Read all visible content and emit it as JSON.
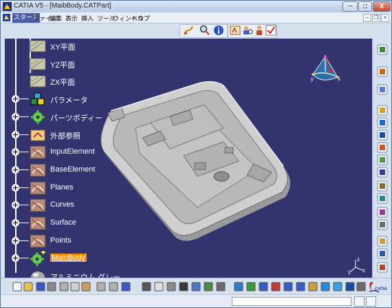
{
  "window": {
    "title": "CATIA V5 - [MaibBody.CATPart]",
    "buttons": {
      "minimize": "─",
      "maximize": "□",
      "close": "X"
    }
  },
  "menubar": {
    "items": [
      "スタート",
      "ファイル",
      "編集",
      "表示",
      "挿入",
      "ツール",
      "ウィンドウ",
      "ヘルプ"
    ],
    "active_index": 0
  },
  "tree": {
    "nodes": [
      {
        "label": "XY平面",
        "icon": "plane-icon"
      },
      {
        "label": "YZ平面",
        "icon": "plane-icon"
      },
      {
        "label": "ZX平面",
        "icon": "plane-icon"
      },
      {
        "label": "パラメータ",
        "icon": "parameters-icon"
      },
      {
        "label": "パーツボディー",
        "icon": "partbody-gear-icon"
      },
      {
        "label": "外部参照",
        "icon": "external-reference-icon"
      },
      {
        "label": "InputElement",
        "icon": "geometrical-set-icon"
      },
      {
        "label": "BaseElement",
        "icon": "geometrical-set-icon"
      },
      {
        "label": "Planes",
        "icon": "geometrical-set-icon"
      },
      {
        "label": "Curves",
        "icon": "geometrical-set-icon"
      },
      {
        "label": "Surface",
        "icon": "geometrical-set-icon"
      },
      {
        "label": "Points",
        "icon": "geometrical-set-icon"
      },
      {
        "label": "MainBody",
        "icon": "mainbody-gear-icon",
        "selected": true
      },
      {
        "label": "アルミニウム グレー",
        "icon": "material-sphere-icon"
      }
    ]
  },
  "compass": {
    "x": "x",
    "y": "y",
    "z": "z"
  },
  "axis_triad": {
    "x": "x",
    "y": "y",
    "z": "z"
  },
  "logo": {
    "text": "CATIA"
  },
  "colors": {
    "viewport_bg": "#33336f",
    "selection": "#ff8c00",
    "part_gray": "#c8c8c8",
    "toolbar_bg": "#d6e1ef"
  },
  "statusbar": {
    "command_value": ""
  }
}
